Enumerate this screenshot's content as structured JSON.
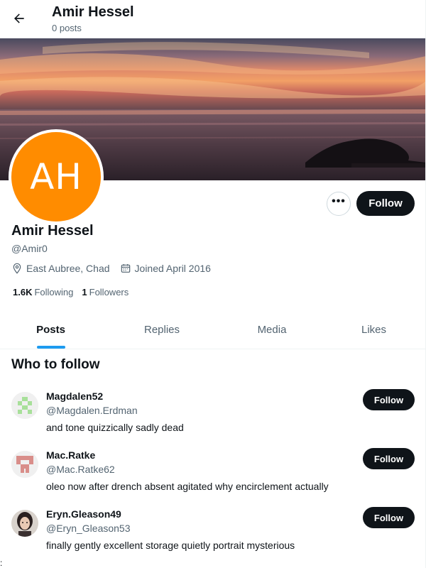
{
  "header": {
    "title": "Amir Hessel",
    "post_count": "0 posts"
  },
  "profile": {
    "avatar_initials": "AH",
    "avatar_color": "#ff8c00",
    "name": "Amir Hessel",
    "handle": "@Amir0",
    "location": "East Aubree, Chad",
    "joined": "Joined April 2016",
    "following_count": "1.6K",
    "following_label": "Following",
    "followers_count": "1",
    "followers_label": "Followers",
    "more_label": "•••",
    "follow_label": "Follow"
  },
  "tabs": [
    {
      "label": "Posts",
      "active": true
    },
    {
      "label": "Replies",
      "active": false
    },
    {
      "label": "Media",
      "active": false
    },
    {
      "label": "Likes",
      "active": false
    }
  ],
  "who_to_follow": {
    "title": "Who to follow",
    "users": [
      {
        "name": "Magdalen52",
        "handle": "@Magdalen.Erdman",
        "bio": "and tone quizzically sadly dead",
        "follow_label": "Follow"
      },
      {
        "name": "Mac.Ratke",
        "handle": "@Mac.Ratke62",
        "bio": "oleo now after drench absent agitated why encirclement actually",
        "follow_label": "Follow"
      },
      {
        "name": "Eryn.Gleason49",
        "handle": "@Eryn_Gleason53",
        "bio": "finally gently excellent storage quietly portrait mysterious",
        "follow_label": "Follow"
      }
    ]
  },
  "stray_mark": ":",
  "colors": {
    "accent": "#1d9bf0",
    "button_dark": "#0f1419",
    "secondary_text": "#536471"
  }
}
